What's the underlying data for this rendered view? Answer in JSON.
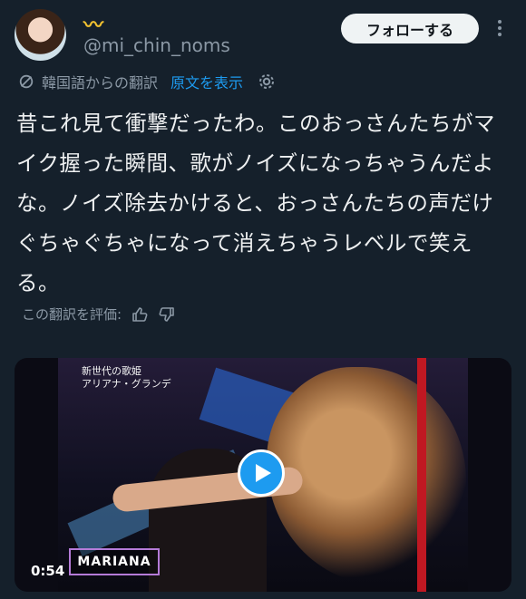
{
  "user": {
    "display_name": "〰",
    "handle": "@mi_chin_noms",
    "follow_label": "フォローする"
  },
  "translation": {
    "label": "韓国語からの翻訳",
    "show_original": "原文を表示"
  },
  "tweet": {
    "text": "昔これ見て衝撃だったわ。このおっさんたちがマイク握った瞬間、歌がノイズになっちゃうんだよな。ノイズ除去かけると、おっさんたちの声だけぐちゃぐちゃになって消えちゃうレベルで笑える。"
  },
  "rating": {
    "label": "この翻訳を評価:"
  },
  "video": {
    "caption_line1": "新世代の歌姫",
    "caption_line2": "アリアナ・グランデ",
    "duration": "0:54",
    "title": "MARIANA"
  },
  "colors": {
    "background": "#15202b",
    "link": "#1d9bf0",
    "muted": "#8b98a5"
  }
}
